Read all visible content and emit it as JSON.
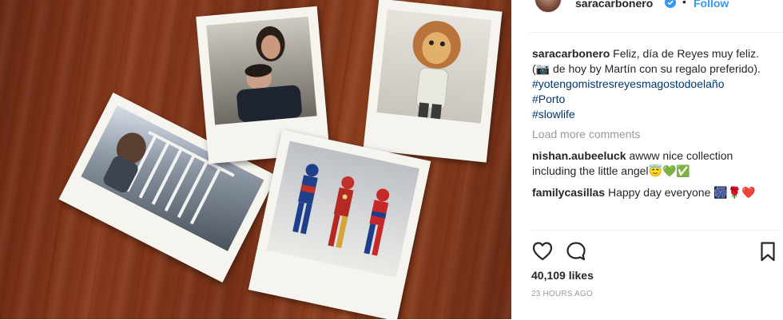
{
  "header": {
    "username": "saracarbonero",
    "separator": "•",
    "follow_label": "Follow",
    "verified_icon": "verified-badge-icon"
  },
  "caption": {
    "username": "saracarbonero",
    "text": "Feliz, día de Reyes muy feliz. (📷 de hoy by Martín con su regalo preferido).",
    "hashtags": [
      "#yotengomistresreyesmagostodoelaño",
      "#Porto",
      "#slowlife"
    ]
  },
  "load_more_label": "Load more comments",
  "comments": [
    {
      "username": "nishan.aubeeluck",
      "text": "awww nice collection including the little angel😇💚✅"
    },
    {
      "username": "familycasillas",
      "text": "Happy day everyone 🎆🌹❤️"
    }
  ],
  "actions": {
    "like_icon": "heart-outline-icon",
    "comment_icon": "comment-bubble-icon",
    "save_icon": "bookmark-icon"
  },
  "likes": {
    "count": "40,109",
    "label": "likes"
  },
  "timestamp": "23 HOURS AGO",
  "colors": {
    "link": "#003569",
    "follow": "#3897f0",
    "muted": "#999999"
  }
}
